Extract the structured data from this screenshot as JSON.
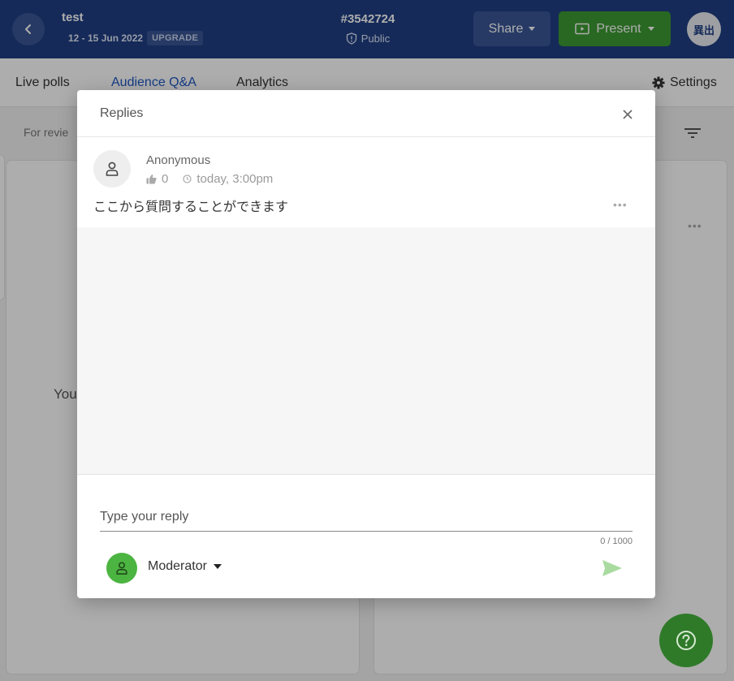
{
  "header": {
    "event_title": "test",
    "event_dates": "12 - 15 Jun 2022",
    "upgrade_label": "UPGRADE",
    "event_code": "#3542724",
    "privacy_label": "Public",
    "share_label": "Share",
    "present_label": "Present",
    "user_initials": "異出",
    "bar_color": "#1f3f84",
    "present_color": "#3d9a33"
  },
  "tabs": [
    {
      "label": "Live polls",
      "active": false
    },
    {
      "label": "Audience Q&A",
      "active": true
    },
    {
      "label": "Analytics",
      "active": false
    }
  ],
  "settings_label": "Settings",
  "background": {
    "filter_text": "For revie",
    "left_panel_text": "You"
  },
  "modal": {
    "title": "Replies",
    "question": {
      "author": "Anonymous",
      "likes": "0",
      "time": "today, 3:00pm",
      "text": "ここから質問することができます"
    },
    "reply": {
      "placeholder": "Type your reply",
      "value": "",
      "char_count": "0 / 1000"
    },
    "author_role": "Moderator"
  },
  "icons": {
    "back": "chevron-left-icon",
    "privacy": "info-shield-icon",
    "present": "present-screen-icon",
    "settings": "gear-icon",
    "filter": "filter-icon",
    "close": "close-icon",
    "avatar": "user-icon",
    "like": "thumbs-up-icon",
    "time": "clock-icon",
    "send": "send-icon",
    "help": "help-icon"
  }
}
